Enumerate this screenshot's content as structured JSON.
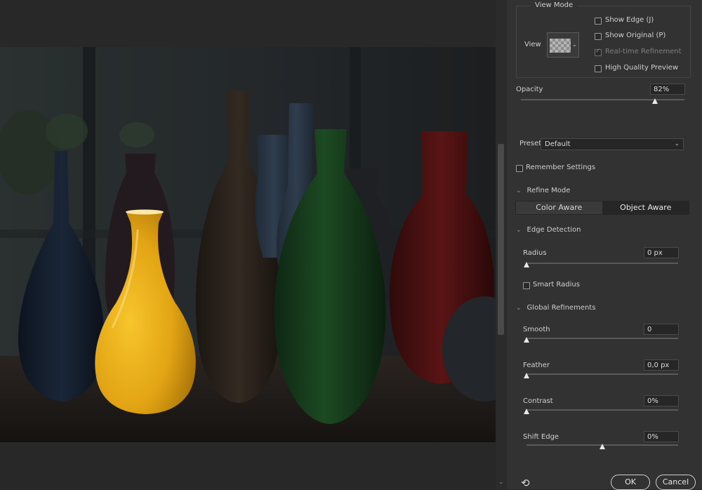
{
  "view_mode": {
    "title": "View Mode",
    "view_label": "View",
    "show_edge": {
      "label": "Show Edge (J)",
      "checked": false
    },
    "show_original": {
      "label": "Show Original (P)",
      "checked": false
    },
    "realtime_refinement": {
      "label": "Real-time Refinement",
      "checked": true,
      "disabled": true
    },
    "high_quality_preview": {
      "label": "High Quality Preview",
      "checked": false
    }
  },
  "opacity": {
    "label": "Opacity",
    "value": "82%",
    "level": 0.82
  },
  "preset": {
    "label": "Preset",
    "value": "Default"
  },
  "remember_settings": {
    "label": "Remember Settings",
    "checked": false
  },
  "refine_mode": {
    "title": "Refine Mode",
    "color_aware": "Color Aware",
    "object_aware": "Object Aware",
    "selected": "Object Aware"
  },
  "edge_detection": {
    "title": "Edge Detection",
    "radius": {
      "label": "Radius",
      "value": "0 px",
      "level": 0
    },
    "smart_radius": {
      "label": "Smart Radius",
      "checked": false
    }
  },
  "global_refinements": {
    "title": "Global Refinements",
    "smooth": {
      "label": "Smooth",
      "value": "0",
      "level": 0
    },
    "feather": {
      "label": "Feather",
      "value": "0,0 px",
      "level": 0
    },
    "contrast": {
      "label": "Contrast",
      "value": "0%",
      "level": 0
    },
    "shift_edge": {
      "label": "Shift Edge",
      "value": "0%",
      "level": 0.5
    }
  },
  "buttons": {
    "ok": "OK",
    "cancel": "Cancel"
  },
  "icons": {
    "reset": "reset-icon",
    "dropdown": "chevron-down-icon",
    "collapse": "chevron-down-icon"
  },
  "colors": {
    "panel_bg": "#323232",
    "field_bg": "#262626",
    "accent_vase": "#e8b21a"
  }
}
